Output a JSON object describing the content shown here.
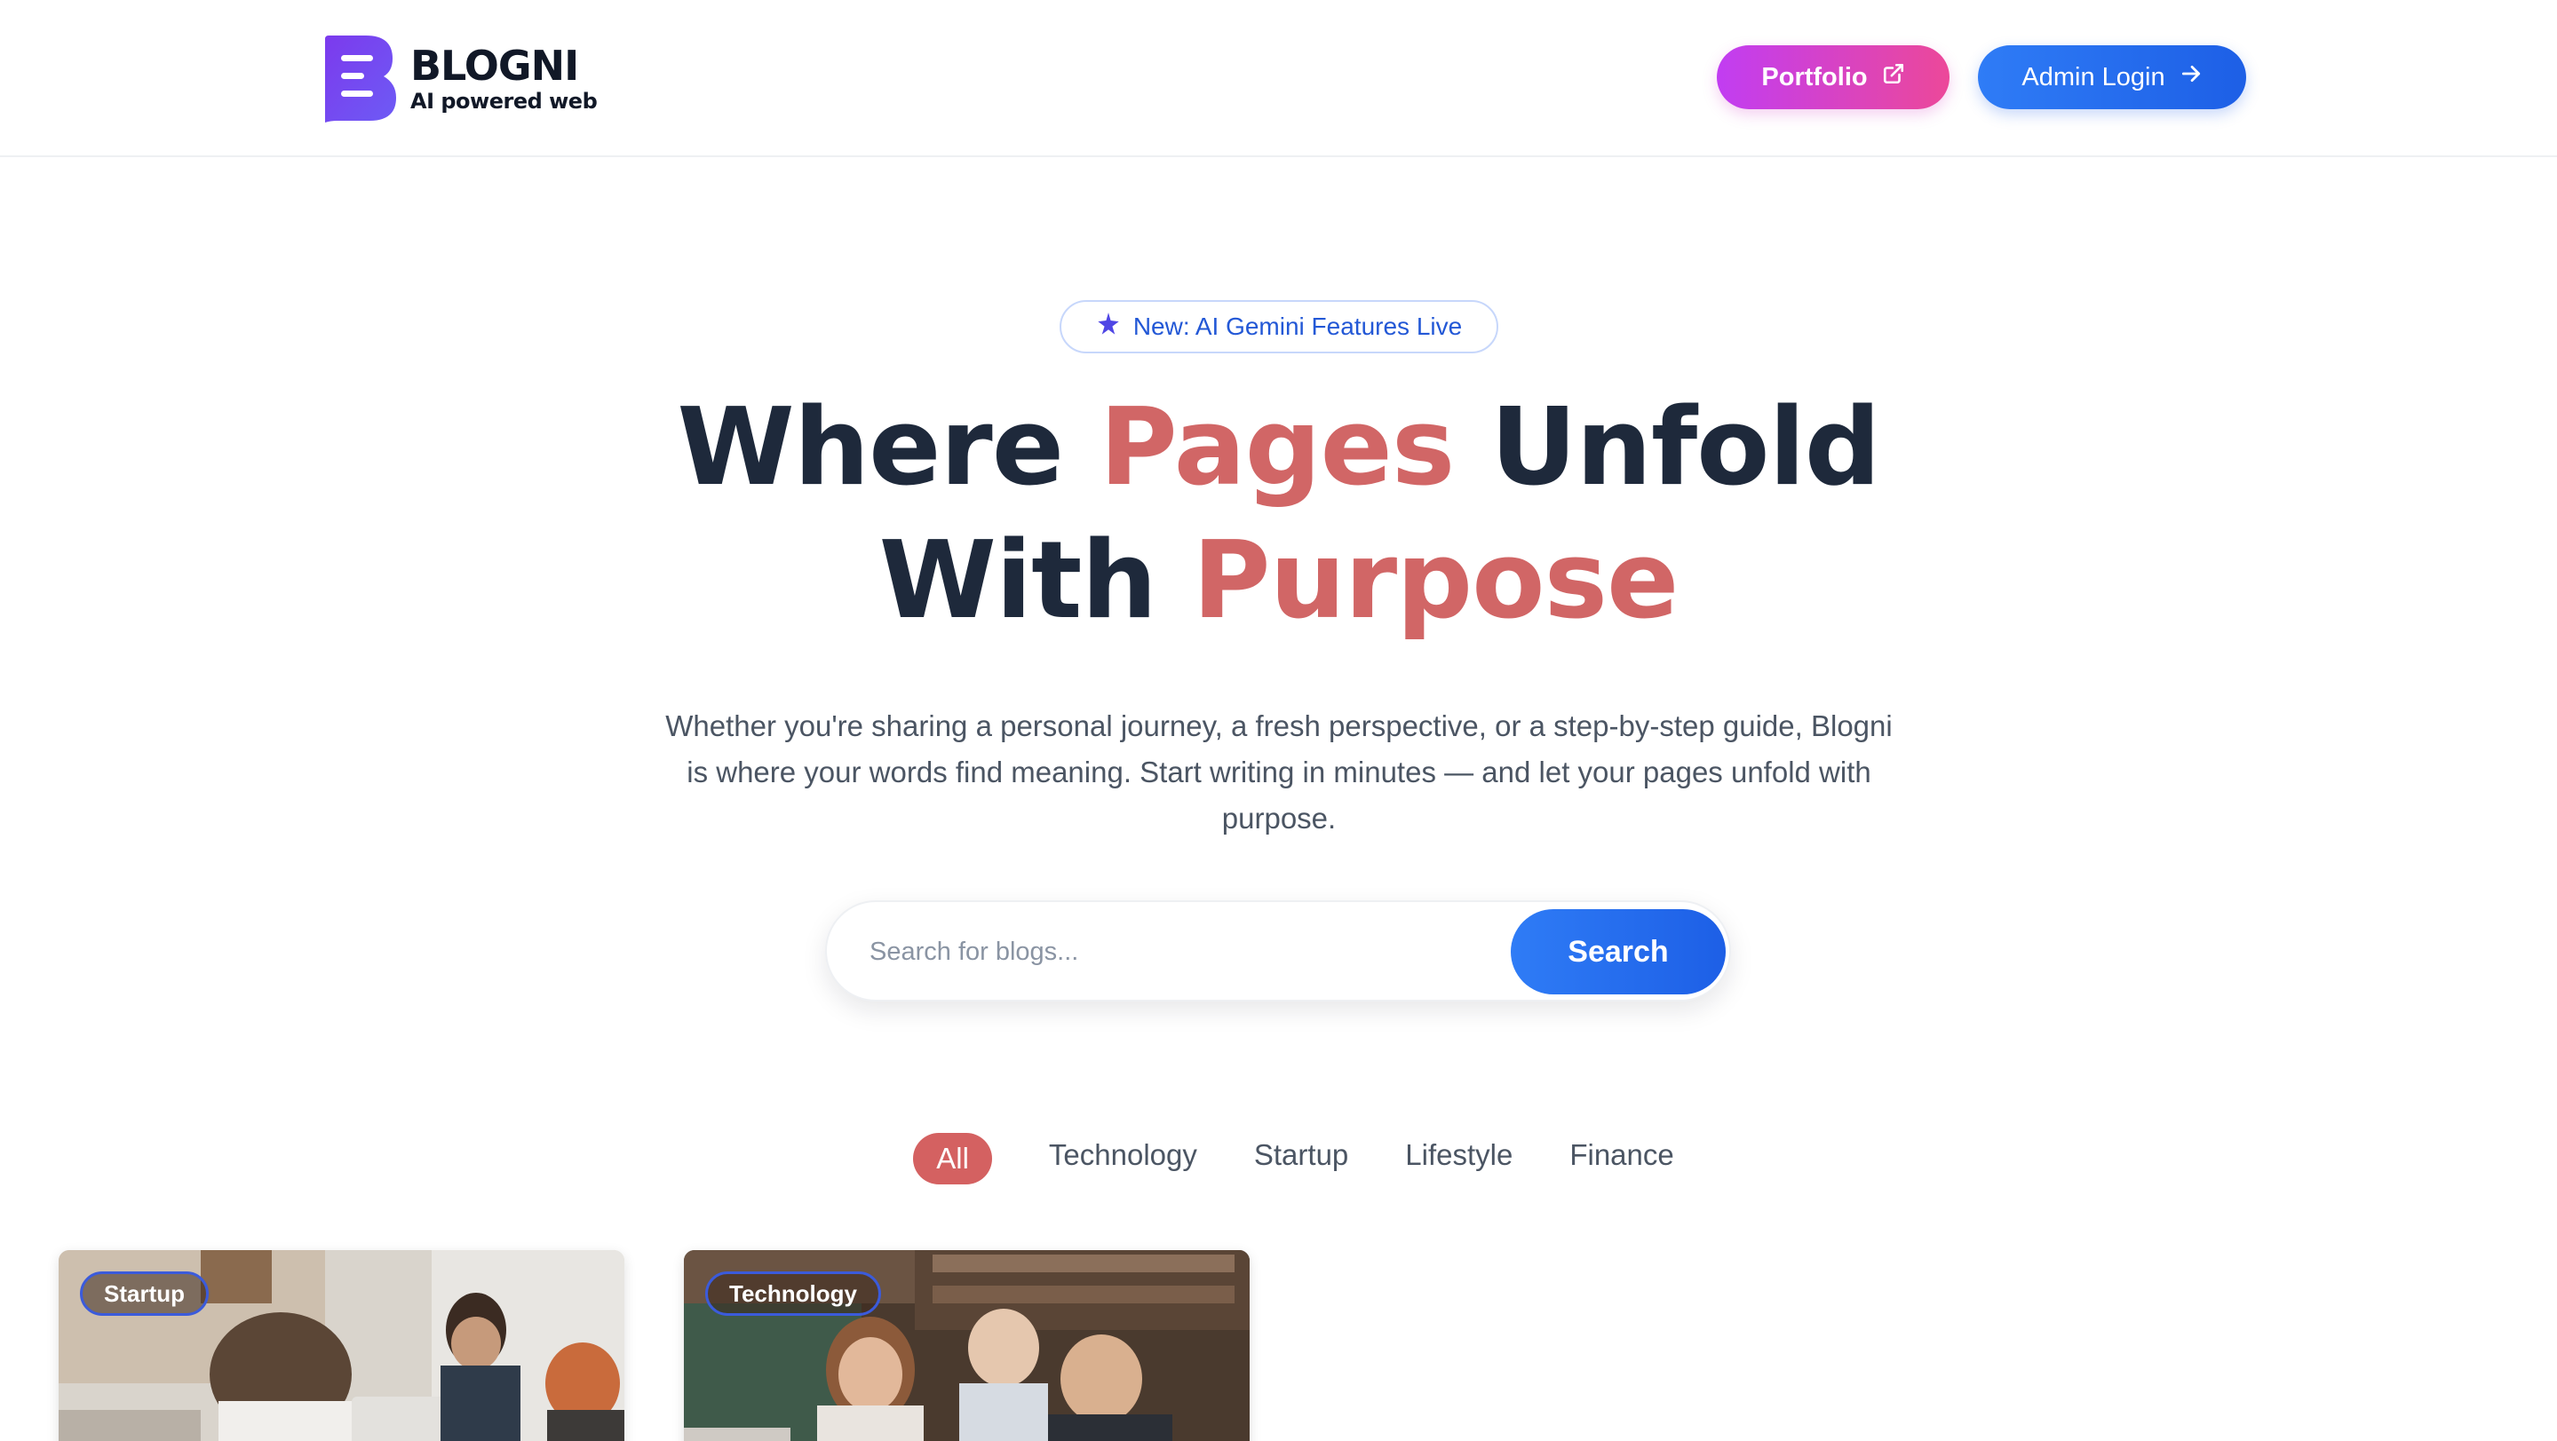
{
  "header": {
    "brand_name": "BLOGNI",
    "brand_tagline": "AI powered web",
    "portfolio_label": "Portfolio",
    "admin_label": "Admin Login"
  },
  "hero": {
    "badge": "New: AI Gemini Features Live",
    "title_line1_a": "Where ",
    "title_line1_b": "Pages",
    "title_line1_c": " Unfold",
    "title_line2_a": "With ",
    "title_line2_b": "Purpose",
    "description": "Whether you're sharing a personal journey, a fresh perspective, or a step-by-step guide, Blogni is where your words find meaning. Start writing in minutes — and let your pages unfold with purpose."
  },
  "search": {
    "placeholder": "Search for blogs...",
    "button_label": "Search"
  },
  "categories": [
    {
      "label": "All",
      "active": true
    },
    {
      "label": "Technology",
      "active": false
    },
    {
      "label": "Startup",
      "active": false
    },
    {
      "label": "Lifestyle",
      "active": false
    },
    {
      "label": "Finance",
      "active": false
    }
  ],
  "cards": [
    {
      "tag": "Startup"
    },
    {
      "tag": "Technology"
    }
  ],
  "colors": {
    "accent": "#d16666",
    "primary_blue": "#2563eb",
    "portfolio_gradient_start": "#c13df2",
    "portfolio_gradient_end": "#ec4899",
    "title": "#1e293b"
  },
  "icons": {
    "logo": "blogni-logo-icon",
    "portfolio": "external-link-icon",
    "admin": "arrow-right-icon",
    "badge": "sparkle-icon"
  }
}
